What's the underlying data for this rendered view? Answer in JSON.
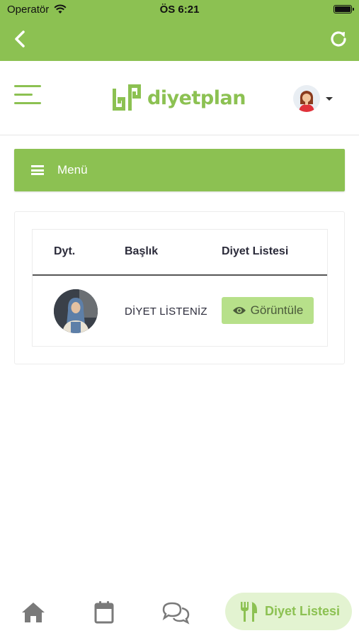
{
  "status_bar": {
    "carrier": "Operatör",
    "time": "ÖS 6:21"
  },
  "nav": {
    "back_icon": "chevron-left-icon",
    "refresh_icon": "refresh-icon"
  },
  "header": {
    "logo_text": "diyetplan",
    "menu_icon": "hamburger-icon",
    "avatar_icon": "user-avatar-icon"
  },
  "menu_bar": {
    "label": "Menü"
  },
  "table": {
    "headers": [
      "Dyt.",
      "Başlık",
      "Diyet Listesi"
    ],
    "rows": [
      {
        "title": "DİYET LİSTENİZ",
        "action_label": "Görüntüle",
        "action_icon": "eye-icon"
      }
    ]
  },
  "tab_bar": {
    "items": [
      {
        "icon": "home-icon"
      },
      {
        "icon": "calendar-icon"
      },
      {
        "icon": "chat-icon"
      },
      {
        "icon": "utensils-icon",
        "label": "Diyet Listesi",
        "active": true
      }
    ]
  },
  "colors": {
    "brand": "#8cc152",
    "button_light": "#b7e08a",
    "tab_active_bg": "#e3f3d1"
  }
}
